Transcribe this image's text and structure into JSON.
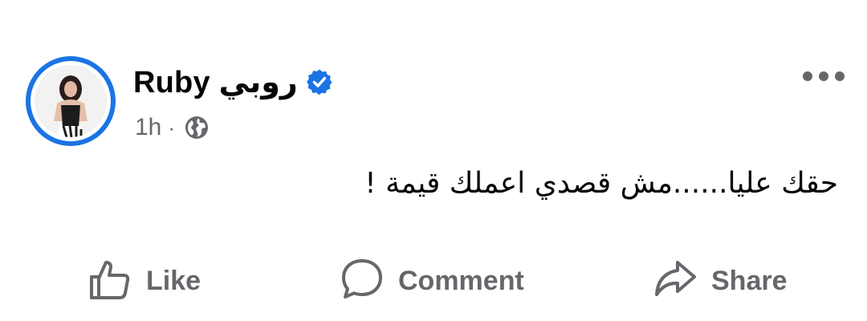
{
  "post": {
    "author": {
      "name": "Ruby روبي",
      "verified": true,
      "avatar": "avatar-photo"
    },
    "meta": {
      "time": "1h",
      "separator": "·",
      "audience_icon": "globe-icon"
    },
    "more_icon": "more-options-icon",
    "text": "حقك عليا......مش قصدي اعملك قيمة !",
    "actions": {
      "like_label": "Like",
      "comment_label": "Comment",
      "share_label": "Share"
    }
  },
  "colors": {
    "accent": "#1b74e4",
    "secondary_text": "#65676b",
    "primary_text": "#050505",
    "background": "#ffffff"
  }
}
